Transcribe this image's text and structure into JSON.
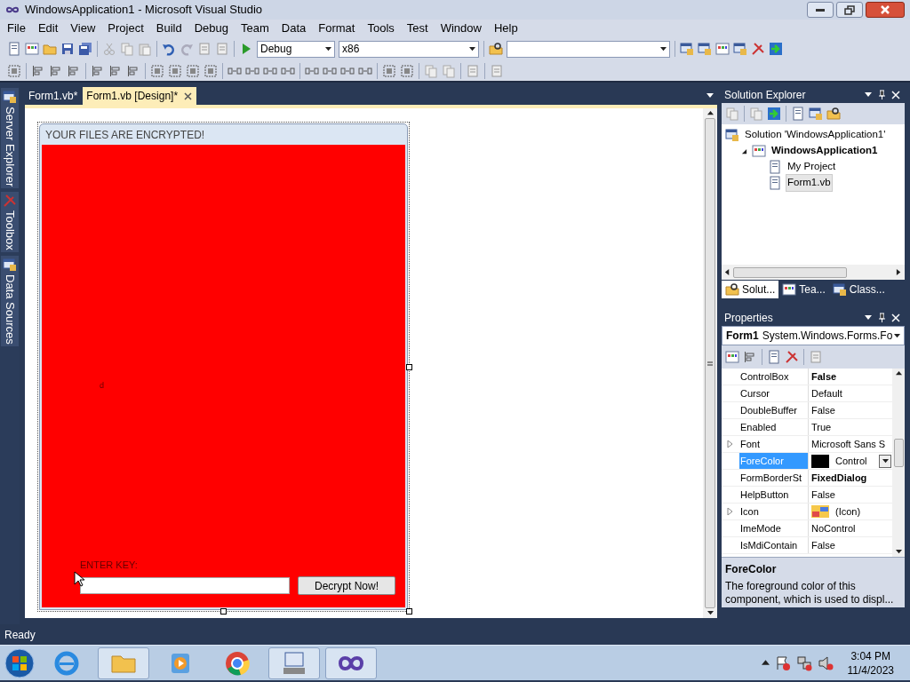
{
  "window": {
    "title": "WindowsApplication1 - Microsoft Visual Studio"
  },
  "menu": [
    "File",
    "Edit",
    "View",
    "Project",
    "Build",
    "Debug",
    "Team",
    "Data",
    "Format",
    "Tools",
    "Test",
    "Window",
    "Help"
  ],
  "toolbar": {
    "configuration": "Debug",
    "platform": "x86"
  },
  "side_tabs": [
    "Server Explorer",
    "Toolbox",
    "Data Sources"
  ],
  "document_tabs": [
    {
      "label": "Form1.vb*",
      "selected": false
    },
    {
      "label": "Form1.vb [Design]*",
      "selected": true
    }
  ],
  "form": {
    "title": "YOUR FILES ARE ENCRYPTED!",
    "small_label": "d",
    "key_label": "ENTER KEY:",
    "button": "Decrypt Now!"
  },
  "solution_explorer": {
    "title": "Solution Explorer",
    "tree": [
      {
        "label": "Solution 'WindowsApplication1'",
        "bold": false,
        "selected": false,
        "children": [
          {
            "label": "WindowsApplication1",
            "bold": true,
            "selected": false,
            "children": [
              {
                "label": "My Project",
                "bold": false,
                "selected": false
              },
              {
                "label": "Form1.vb",
                "bold": false,
                "selected": true
              }
            ]
          }
        ]
      }
    ],
    "tabs": [
      {
        "label": "Solut...",
        "selected": true
      },
      {
        "label": "Tea...",
        "selected": false
      },
      {
        "label": "Class...",
        "selected": false
      }
    ]
  },
  "properties": {
    "title": "Properties",
    "object_name": "Form1",
    "object_type": "System.Windows.Forms.Fo",
    "rows": [
      {
        "name": "ControlBox",
        "value": "False",
        "kind": "text",
        "bold": true,
        "expandable": false,
        "selected": false
      },
      {
        "name": "Cursor",
        "value": "Default",
        "kind": "text",
        "bold": false,
        "expandable": false,
        "selected": false
      },
      {
        "name": "DoubleBuffer",
        "value": "False",
        "kind": "text",
        "bold": false,
        "expandable": false,
        "selected": false
      },
      {
        "name": "Enabled",
        "value": "True",
        "kind": "text",
        "bold": false,
        "expandable": false,
        "selected": false
      },
      {
        "name": "Font",
        "value": "Microsoft Sans S",
        "kind": "text",
        "bold": false,
        "expandable": true,
        "selected": false
      },
      {
        "name": "ForeColor",
        "value": "Control",
        "kind": "color",
        "color": "#000000",
        "bold": false,
        "expandable": false,
        "selected": true
      },
      {
        "name": "FormBorderSt",
        "value": "FixedDialog",
        "kind": "text",
        "bold": true,
        "expandable": false,
        "selected": false
      },
      {
        "name": "HelpButton",
        "value": "False",
        "kind": "text",
        "bold": false,
        "expandable": false,
        "selected": false
      },
      {
        "name": "Icon",
        "value": "(Icon)",
        "kind": "icon",
        "bold": false,
        "expandable": true,
        "selected": false
      },
      {
        "name": "ImeMode",
        "value": "NoControl",
        "kind": "text",
        "bold": false,
        "expandable": false,
        "selected": false
      },
      {
        "name": "IsMdiContain",
        "value": "False",
        "kind": "text",
        "bold": false,
        "expandable": false,
        "selected": false
      }
    ],
    "description": {
      "title": "ForeColor",
      "text": "The foreground color of this component, which is used to displ..."
    }
  },
  "status_bar": {
    "text": "Ready"
  },
  "taskbar": {
    "time": "3:04 PM",
    "date": "11/4/2023"
  }
}
